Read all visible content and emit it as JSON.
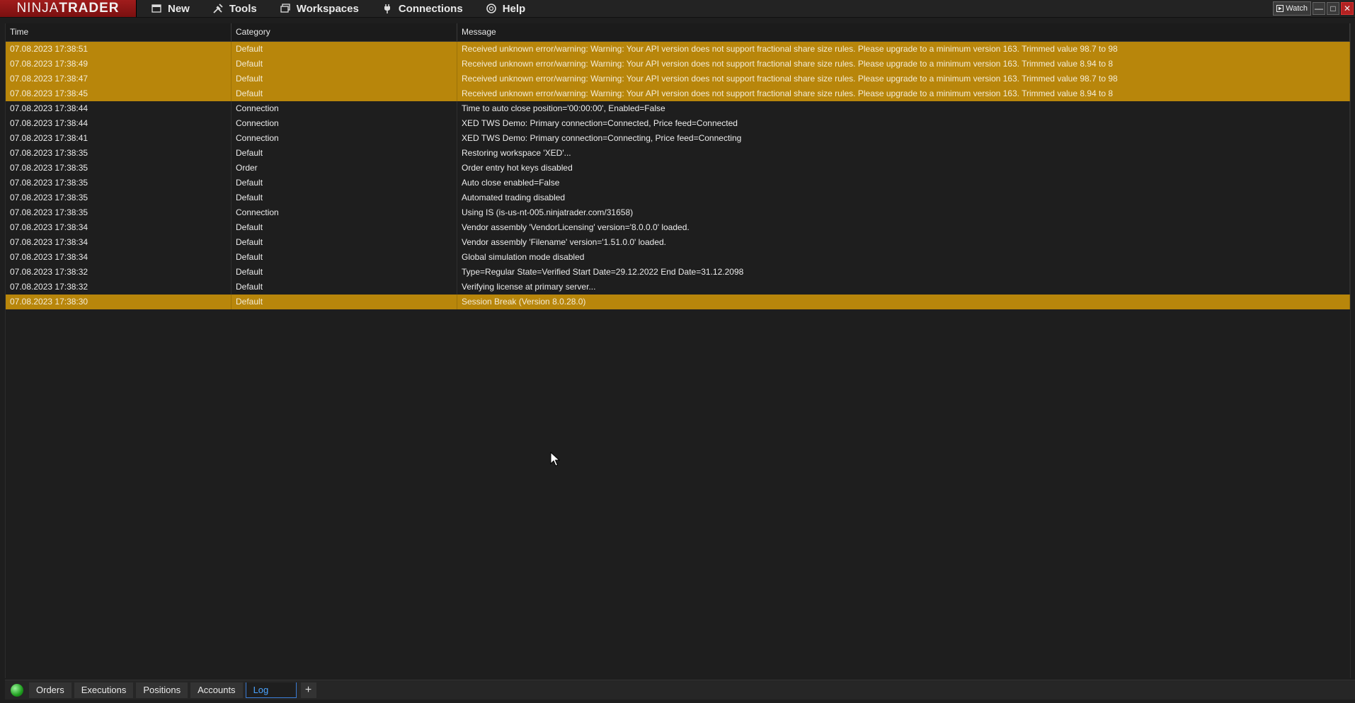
{
  "app": {
    "logo_part1": "NINJA",
    "logo_part2": "TRADER"
  },
  "menu": [
    {
      "label": "New",
      "icon": "new-window-icon"
    },
    {
      "label": "Tools",
      "icon": "tools-icon"
    },
    {
      "label": "Workspaces",
      "icon": "workspaces-icon"
    },
    {
      "label": "Connections",
      "icon": "connections-plug-icon"
    },
    {
      "label": "Help",
      "icon": "help-lifebuoy-icon"
    }
  ],
  "window_controls": {
    "watch_label": "Watch"
  },
  "log": {
    "columns": {
      "time": "Time",
      "category": "Category",
      "message": "Message"
    },
    "rows": [
      {
        "time": "07.08.2023 17:38:51",
        "category": "Default",
        "message": "Received unknown error/warning: Warning: Your API version does not support fractional share size rules. Please upgrade to a minimum version 163. Trimmed value 98.7 to 98",
        "highlight": true
      },
      {
        "time": "07.08.2023 17:38:49",
        "category": "Default",
        "message": "Received unknown error/warning: Warning: Your API version does not support fractional share size rules. Please upgrade to a minimum version 163. Trimmed value 8.94 to 8",
        "highlight": true
      },
      {
        "time": "07.08.2023 17:38:47",
        "category": "Default",
        "message": "Received unknown error/warning: Warning: Your API version does not support fractional share size rules. Please upgrade to a minimum version 163. Trimmed value 98.7 to 98",
        "highlight": true
      },
      {
        "time": "07.08.2023 17:38:45",
        "category": "Default",
        "message": "Received unknown error/warning: Warning: Your API version does not support fractional share size rules. Please upgrade to a minimum version 163. Trimmed value 8.94 to 8",
        "highlight": true
      },
      {
        "time": "07.08.2023 17:38:44",
        "category": "Connection",
        "message": "Time to auto close position='00:00:00', Enabled=False",
        "highlight": false
      },
      {
        "time": "07.08.2023 17:38:44",
        "category": "Connection",
        "message": "XED TWS Demo: Primary connection=Connected, Price feed=Connected",
        "highlight": false
      },
      {
        "time": "07.08.2023 17:38:41",
        "category": "Connection",
        "message": "XED TWS Demo: Primary connection=Connecting, Price feed=Connecting",
        "highlight": false
      },
      {
        "time": "07.08.2023 17:38:35",
        "category": "Default",
        "message": "Restoring workspace 'XED'...",
        "highlight": false
      },
      {
        "time": "07.08.2023 17:38:35",
        "category": "Order",
        "message": "Order entry hot keys disabled",
        "highlight": false
      },
      {
        "time": "07.08.2023 17:38:35",
        "category": "Default",
        "message": "Auto close enabled=False",
        "highlight": false
      },
      {
        "time": "07.08.2023 17:38:35",
        "category": "Default",
        "message": "Automated trading disabled",
        "highlight": false
      },
      {
        "time": "07.08.2023 17:38:35",
        "category": "Connection",
        "message": "Using IS (is-us-nt-005.ninjatrader.com/31658)",
        "highlight": false
      },
      {
        "time": "07.08.2023 17:38:34",
        "category": "Default",
        "message": "Vendor assembly 'VendorLicensing' version='8.0.0.0' loaded.",
        "highlight": false
      },
      {
        "time": "07.08.2023 17:38:34",
        "category": "Default",
        "message": "Vendor assembly 'Filename' version='1.51.0.0' loaded.",
        "highlight": false
      },
      {
        "time": "07.08.2023 17:38:34",
        "category": "Default",
        "message": "Global simulation mode disabled",
        "highlight": false
      },
      {
        "time": "07.08.2023 17:38:32",
        "category": "Default",
        "message": "Type=Regular State=Verified Start Date=29.12.2022 End Date=31.12.2098",
        "highlight": false
      },
      {
        "time": "07.08.2023 17:38:32",
        "category": "Default",
        "message": "Verifying license at primary server...",
        "highlight": false
      },
      {
        "time": "07.08.2023 17:38:30",
        "category": "Default",
        "message": "Session Break (Version 8.0.28.0)",
        "highlight": true
      }
    ]
  },
  "tabs": [
    {
      "label": "Orders",
      "active": false
    },
    {
      "label": "Executions",
      "active": false
    },
    {
      "label": "Positions",
      "active": false
    },
    {
      "label": "Accounts",
      "active": false
    },
    {
      "label": "Log",
      "active": true
    }
  ],
  "add_tab_label": "+",
  "colors": {
    "highlight_row": "#b8860b",
    "active_tab_text": "#4aa3ff",
    "logo_red": "#a11c1c",
    "status_green": "#1f9d1f"
  }
}
